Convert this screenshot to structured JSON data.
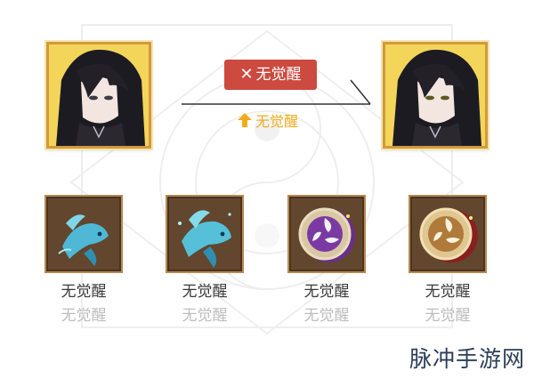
{
  "badge": {
    "label": "无觉醒",
    "icon": "crossed-swords-icon",
    "color": "#cc4a3f"
  },
  "upgrade": {
    "label": "无觉醒",
    "icon": "up-arrow-icon",
    "color": "#f0ac1b"
  },
  "items": [
    {
      "icon": "blue-koi-fish-icon",
      "label": "无觉醒",
      "sublabel": "无觉醒"
    },
    {
      "icon": "blue-koi-fish-icon",
      "label": "无觉醒",
      "sublabel": "无觉醒"
    },
    {
      "icon": "purple-tomoe-drum-icon",
      "label": "无觉醒",
      "sublabel": "无觉醒"
    },
    {
      "icon": "gold-tomoe-drum-icon",
      "label": "无觉醒",
      "sublabel": "无觉醒"
    }
  ],
  "watermark": "脉冲手游网"
}
